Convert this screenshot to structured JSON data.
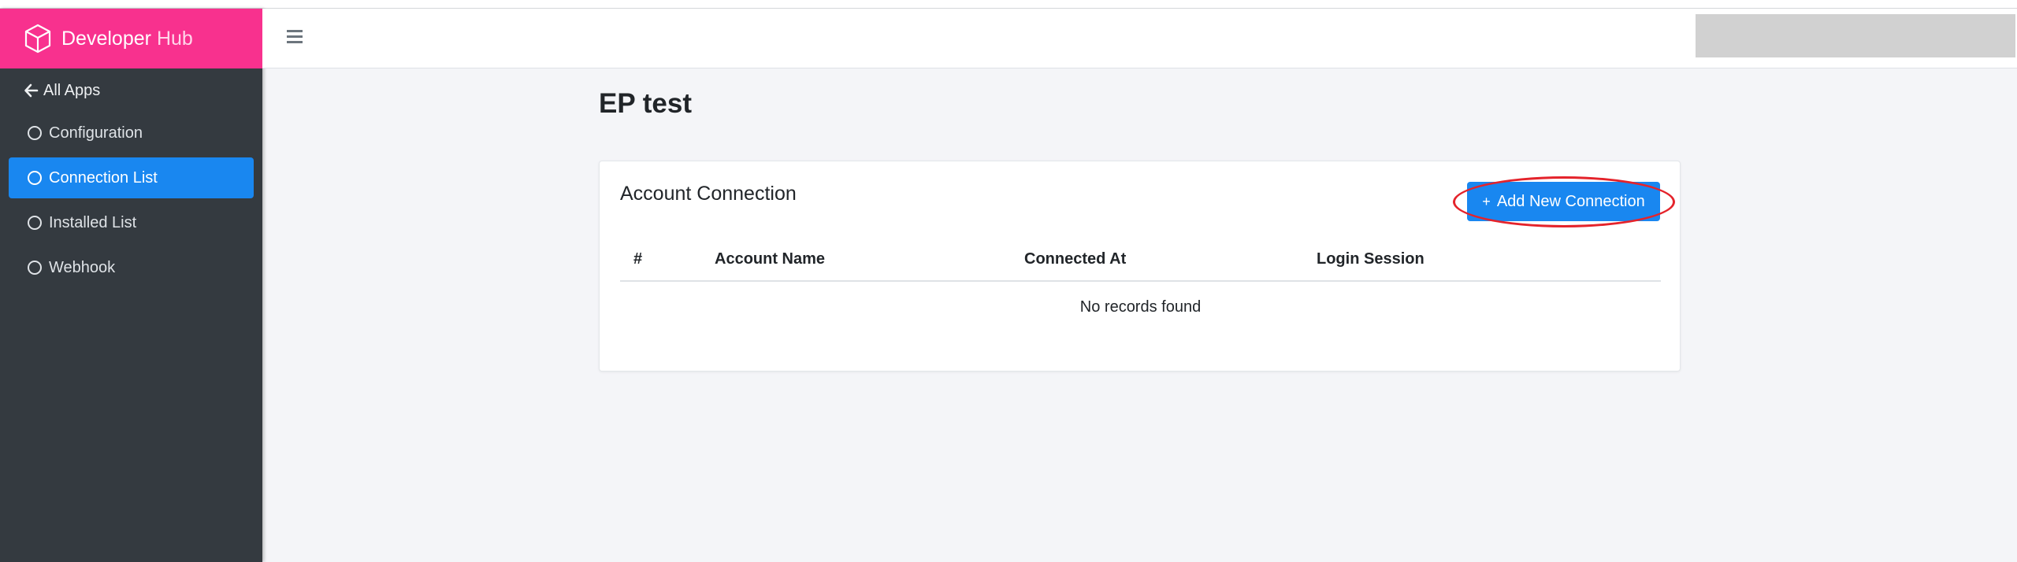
{
  "brand": {
    "name_part1": "Developer",
    "name_part2": "Hub",
    "icon": "cube-icon",
    "color": "#f8318e"
  },
  "sidebar": {
    "back_label": "All Apps",
    "items": [
      {
        "label": "Configuration",
        "active": false
      },
      {
        "label": "Connection List",
        "active": true
      },
      {
        "label": "Installed List",
        "active": false
      },
      {
        "label": "Webhook",
        "active": false
      }
    ],
    "bg_color": "#343a40",
    "active_color": "#1987f0"
  },
  "header": {
    "menu_icon": "hamburger-icon"
  },
  "page": {
    "title": "EP test"
  },
  "card": {
    "title": "Account Connection",
    "add_button_label": "Add New Connection",
    "add_button_icon": "plus-icon",
    "table": {
      "columns": [
        "#",
        "Account Name",
        "Connected At",
        "Login Session"
      ],
      "empty_text": "No records found"
    }
  }
}
